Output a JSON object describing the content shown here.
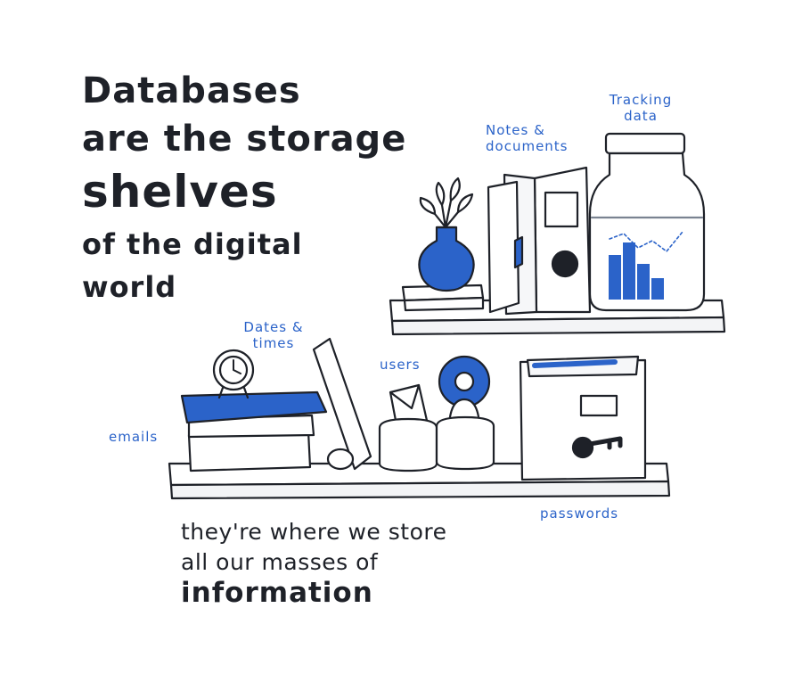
{
  "title_lines": [
    "Databases",
    "are the storage",
    "shelves",
    "of the digital",
    "world"
  ],
  "labels": {
    "tracking_data": [
      "Tracking",
      "data"
    ],
    "notes_documents": [
      "Notes &",
      "documents"
    ],
    "dates_times": [
      "Dates &",
      "times"
    ],
    "users": "users",
    "emails": "emails",
    "passwords": "passwords"
  },
  "footer_lines": [
    "they're where we store",
    "all our masses of",
    "information"
  ],
  "colors": {
    "accent": "#2b63c9",
    "ink": "#1e2128"
  }
}
